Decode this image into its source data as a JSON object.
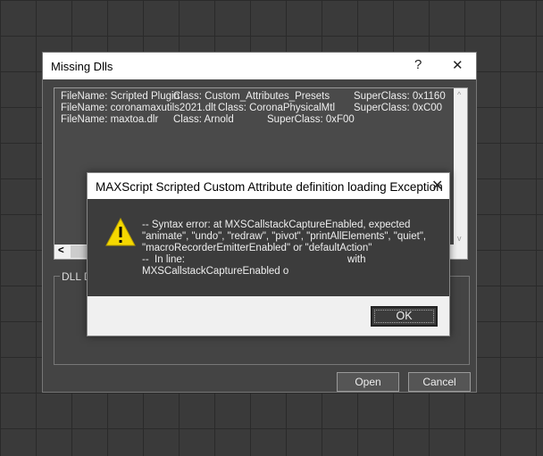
{
  "outer_dialog": {
    "title": "Missing Dlls",
    "help": "?",
    "close": "✕",
    "entries": [
      {
        "file": "FileName:  Scripted Plugin",
        "class": "Class: Custom_Attributes_Presets",
        "super": "SuperClass: 0x1160"
      },
      {
        "file": "FileName:  coronamaxutils2021.dlt",
        "class": "Class: CoronaPhysicalMtl",
        "super": "SuperClass: 0xC00"
      },
      {
        "file": "FileName:  maxtoa.dlr",
        "class": "Class: Arnold",
        "super": "SuperClass: 0xF00"
      }
    ],
    "group_label": "DLL De",
    "open_label": "Open",
    "cancel_label": "Cancel",
    "scroll_left": "<",
    "scroll_up": "^",
    "scroll_down": "v"
  },
  "error_dialog": {
    "title": "MAXScript Scripted Custom Attribute definition loading Exception",
    "close": "✕",
    "lines": [
      "-- Syntax error: at MXSCallstackCaptureEnabled, expected",
      "\"animate\", \"undo\", \"redraw\", \"pivot\", \"printAllElements\", \"quiet\",",
      "\"macroRecorderEmitterEnabled\" or \"defaultAction\"",
      "--  In line:                                                         with",
      "MXSCallstackCaptureEnabled o"
    ],
    "ok_label": "OK",
    "warning_color": "#f5d800"
  }
}
